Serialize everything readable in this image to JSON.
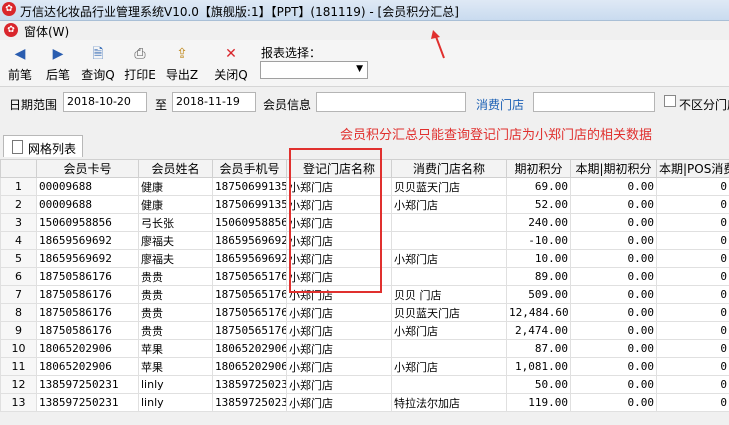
{
  "title": "万信达化妆品行业管理系统V10.0【旗舰版:1】【PPT】(181119) - [会员积分汇总]",
  "menu": {
    "window": "窗体(W)"
  },
  "toolbar": {
    "prev": "前笔",
    "next": "后笔",
    "query": "查询Q",
    "print": "打印E",
    "export": "导出Z",
    "close": "关闭Q",
    "report_label": "报表选择：",
    "report_value": ""
  },
  "filter": {
    "date_label": "日期范围",
    "date_from": "2018-10-20",
    "to_label": "至",
    "date_to": "2018-11-19",
    "member_label": "会员信息",
    "member_value": "",
    "store_link": "消费门店",
    "store_value": "",
    "nosplit_label": "不区分门店"
  },
  "tab": {
    "label": "网格列表"
  },
  "annotation": {
    "text": "会员积分汇总只能查询登记门店为小郑门店的相关数据"
  },
  "table": {
    "headers": [
      "",
      "会员卡号",
      "会员姓名",
      "会员手机号",
      "登记门店名称",
      "消费门店名称",
      "期初积分",
      "本期|期初积分",
      "本期|POS消费积分"
    ],
    "rows": [
      [
        "1",
        "00009688",
        "健康",
        "18750699135",
        "小郑门店",
        "贝贝蓝天门店",
        "69.00",
        "0.00",
        "0"
      ],
      [
        "2",
        "00009688",
        "健康",
        "18750699135",
        "小郑门店",
        "小郑门店",
        "52.00",
        "0.00",
        "0"
      ],
      [
        "3",
        "15060958856",
        "弓长张",
        "15060958856",
        "小郑门店",
        "",
        "240.00",
        "0.00",
        "0"
      ],
      [
        "4",
        "18659569692",
        "廖福夫",
        "18659569692",
        "小郑门店",
        "",
        "-10.00",
        "0.00",
        "0"
      ],
      [
        "5",
        "18659569692",
        "廖福夫",
        "18659569692",
        "小郑门店",
        "小郑门店",
        "10.00",
        "0.00",
        "0"
      ],
      [
        "6",
        "18750586176",
        "贵贵",
        "18750565176",
        "小郑门店",
        "",
        "89.00",
        "0.00",
        "0"
      ],
      [
        "7",
        "18750586176",
        "贵贵",
        "18750565176",
        "小郑门店",
        "贝贝 门店",
        "509.00",
        "0.00",
        "0"
      ],
      [
        "8",
        "18750586176",
        "贵贵",
        "18750565176",
        "小郑门店",
        "贝贝蓝天门店",
        "12,484.60",
        "0.00",
        "0"
      ],
      [
        "9",
        "18750586176",
        "贵贵",
        "18750565176",
        "小郑门店",
        "小郑门店",
        "2,474.00",
        "0.00",
        "0"
      ],
      [
        "10",
        "18065202906",
        "苹果",
        "18065202906",
        "小郑门店",
        "",
        "87.00",
        "0.00",
        "0"
      ],
      [
        "11",
        "18065202906",
        "苹果",
        "18065202906",
        "小郑门店",
        "小郑门店",
        "1,081.00",
        "0.00",
        "0"
      ],
      [
        "12",
        "138597250231",
        "linly",
        "13859725023",
        "小郑门店",
        "",
        "50.00",
        "0.00",
        "0"
      ],
      [
        "13",
        "138597250231",
        "linly",
        "13859725023",
        "小郑门店",
        "特拉法尔加店",
        "119.00",
        "0.00",
        "0"
      ]
    ]
  },
  "colors": {
    "annotation": "#e0302e",
    "link": "#1a5fb4",
    "brand": "#d9262c"
  }
}
